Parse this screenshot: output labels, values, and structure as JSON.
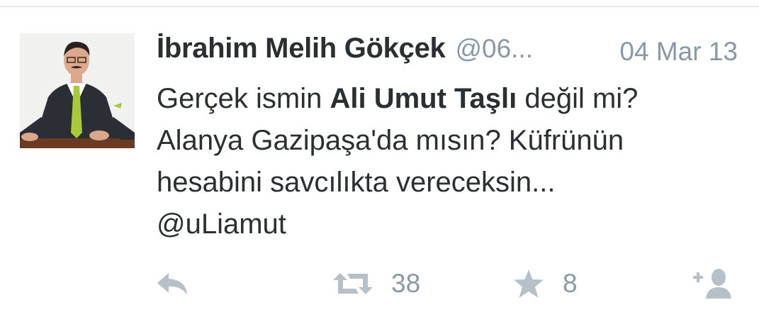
{
  "tweet": {
    "author_name": "İbrahim Melih Gökçek",
    "handle": "@06...",
    "date": "04 Mar 13",
    "text": {
      "line1_pre": "Gerçek ismin ",
      "line1_bold": "Ali Umut Taşlı",
      "line1_post": " değil mi?",
      "line2": "Alanya Gazipaşa'da mısın? Küfrünün",
      "line3": "hesabini savcılıkta vereceksin...",
      "line4": "@uLiamut"
    }
  },
  "actions": {
    "retweet_count": "38",
    "favorite_count": "8"
  },
  "icons": {
    "reply": "reply-icon",
    "retweet": "retweet-icon",
    "favorite": "star-icon",
    "follow": "add-user-icon"
  },
  "colors": {
    "text": "#292f33",
    "muted": "#8899a6",
    "icon": "#b5c0c9"
  }
}
